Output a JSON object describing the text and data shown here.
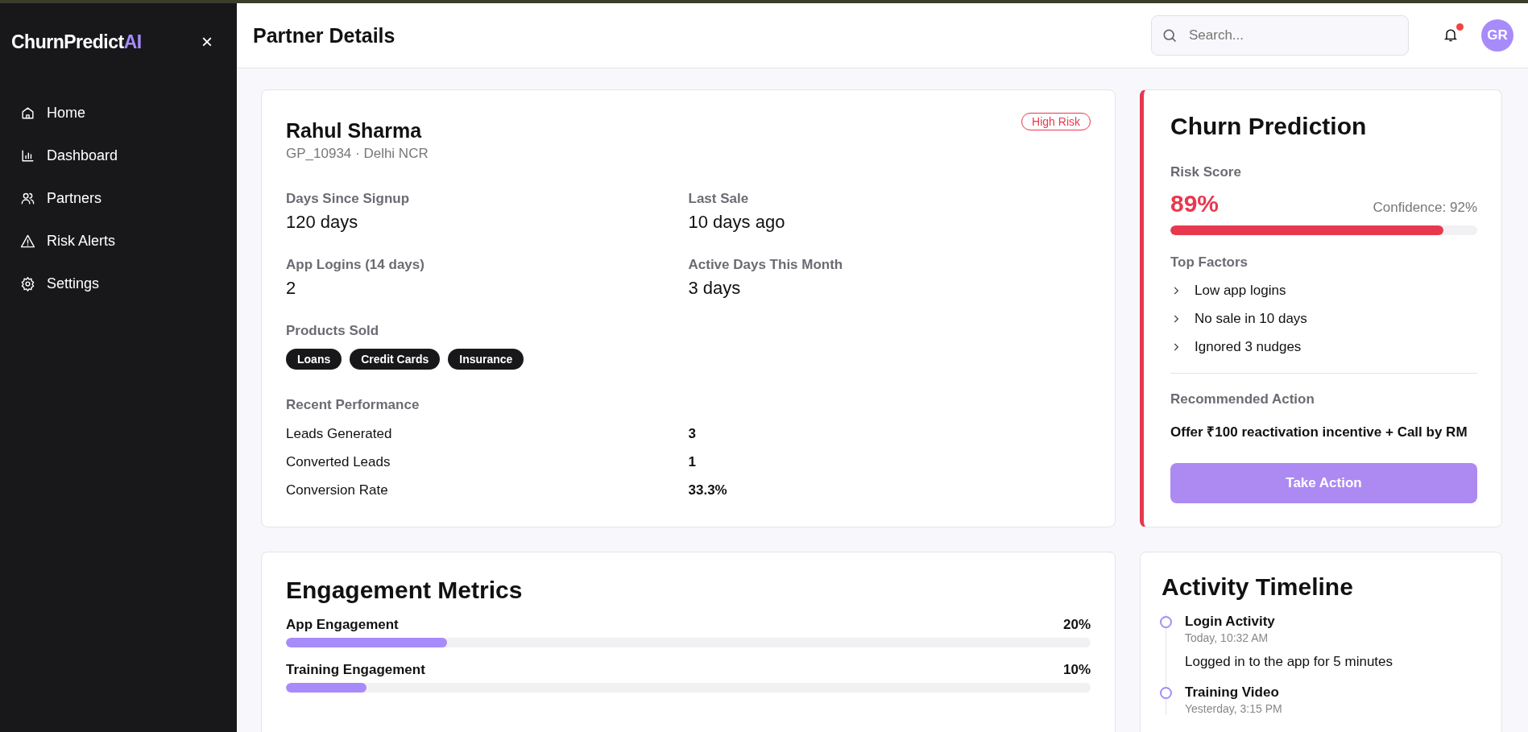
{
  "sidebar": {
    "brand": "ChurnPredict",
    "brand_accent": "AI",
    "close": "×",
    "items": [
      {
        "label": "Home",
        "kind": "home",
        "selected": false
      },
      {
        "label": "Dashboard",
        "kind": "chart",
        "selected": false
      },
      {
        "label": "Partners",
        "kind": "users",
        "selected": false
      },
      {
        "label": "Risk Alerts",
        "kind": "alert",
        "selected": false
      },
      {
        "label": "Settings",
        "kind": "gear",
        "selected": false
      }
    ]
  },
  "header": {
    "title": "Partner Details",
    "search": {
      "placeholder": "Search..."
    },
    "notification_dot": true,
    "avatar": "GR"
  },
  "partner": {
    "name": "Rahul Sharma",
    "meta": "GP_10934 · Delhi NCR",
    "badge": "High Risk",
    "stats": [
      {
        "label": "Days Since Signup",
        "value": "120 days"
      },
      {
        "label": "Last Sale",
        "value": "10 days ago"
      },
      {
        "label": "App Logins (14 days)",
        "value": "2"
      },
      {
        "label": "Active Days This Month",
        "value": "3 days"
      }
    ],
    "products_label": "Products Sold",
    "products": [
      "Loans",
      "Credit Cards",
      "Insurance"
    ],
    "performance_label": "Recent Performance",
    "performance": [
      {
        "label": "Leads Generated",
        "value": "3"
      },
      {
        "label": "Converted Leads",
        "value": "1"
      },
      {
        "label": "Conversion Rate",
        "value": "33.3%"
      }
    ]
  },
  "prediction": {
    "title": "Churn Prediction",
    "risk_label": "Risk Score",
    "risk": "89%",
    "confidence": "Confidence: 92%",
    "level": 0.89,
    "factors_label": "Top Factors",
    "factors": [
      "Low app logins",
      "No sale in 10 days",
      "Ignored 3 nudges"
    ],
    "action_label": "Recommended Action",
    "action": "Offer ₹100 reactivation incentive + Call by RM",
    "button": "Take Action"
  },
  "engagement": {
    "title": "Engagement Metrics",
    "metrics": [
      {
        "label": "App Engagement",
        "value": "20%",
        "level": 0.2
      },
      {
        "label": "Training Engagement",
        "value": "10%",
        "level": 0.1
      }
    ]
  },
  "timeline": {
    "title": "Activity Timeline",
    "events": [
      {
        "title": "Login Activity",
        "time": "Today, 10:32 AM",
        "text": "Logged in to the app for 5 minutes"
      },
      {
        "title": "Training Video",
        "time": "Yesterday, 3:15 PM"
      }
    ]
  }
}
